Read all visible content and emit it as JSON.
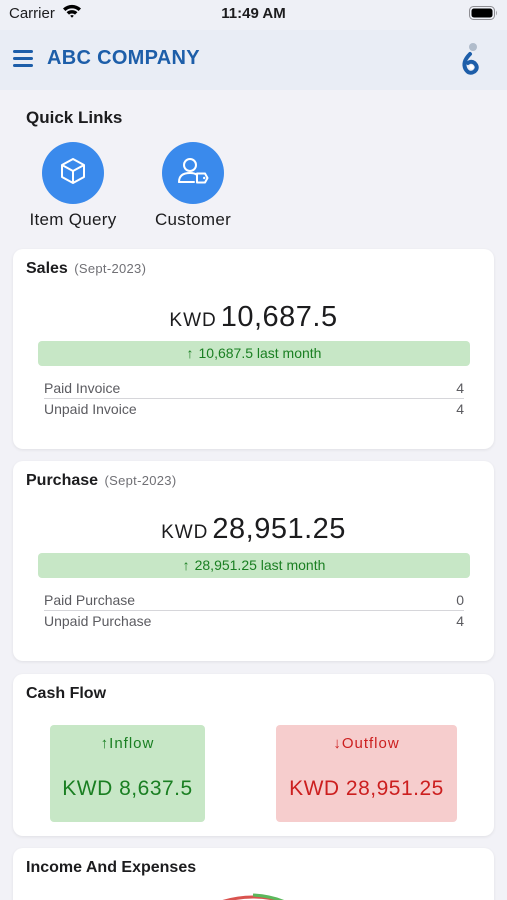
{
  "status_bar": {
    "carrier": "Carrier",
    "time": "11:49 AM"
  },
  "header": {
    "title": "ABC COMPANY"
  },
  "quick_links": {
    "title": "Quick Links",
    "items": [
      {
        "label": "Item Query",
        "icon": "cube-icon"
      },
      {
        "label": "Customer",
        "icon": "user-tag-icon"
      }
    ]
  },
  "sales": {
    "title": "Sales",
    "period": "(Sept-2023)",
    "currency": "KWD",
    "amount": "10,687.5",
    "trend_text": "10,687.5 last month",
    "rows": [
      {
        "label": "Paid Invoice",
        "value": "4"
      },
      {
        "label": "Unpaid Invoice",
        "value": "4"
      }
    ]
  },
  "purchase": {
    "title": "Purchase",
    "period": "(Sept-2023)",
    "currency": "KWD",
    "amount": "28,951.25",
    "trend_text": "28,951.25 last month",
    "rows": [
      {
        "label": "Paid Purchase",
        "value": "0"
      },
      {
        "label": "Unpaid Purchase",
        "value": "4"
      }
    ]
  },
  "cash_flow": {
    "title": "Cash Flow",
    "inflow": {
      "label": "Inflow",
      "amount": "KWD 8,637.5"
    },
    "outflow": {
      "label": "Outflow",
      "amount": "KWD 28,951.25"
    }
  },
  "income_expenses": {
    "title": "Income And Expenses"
  },
  "colors": {
    "brand": "#1d5ea9",
    "quick_link_circle": "#3a8aec",
    "positive_bg": "#c7e7c6",
    "positive_text": "#1a7f22",
    "negative_bg": "#f6cdcd",
    "negative_text": "#cc1f1f"
  }
}
